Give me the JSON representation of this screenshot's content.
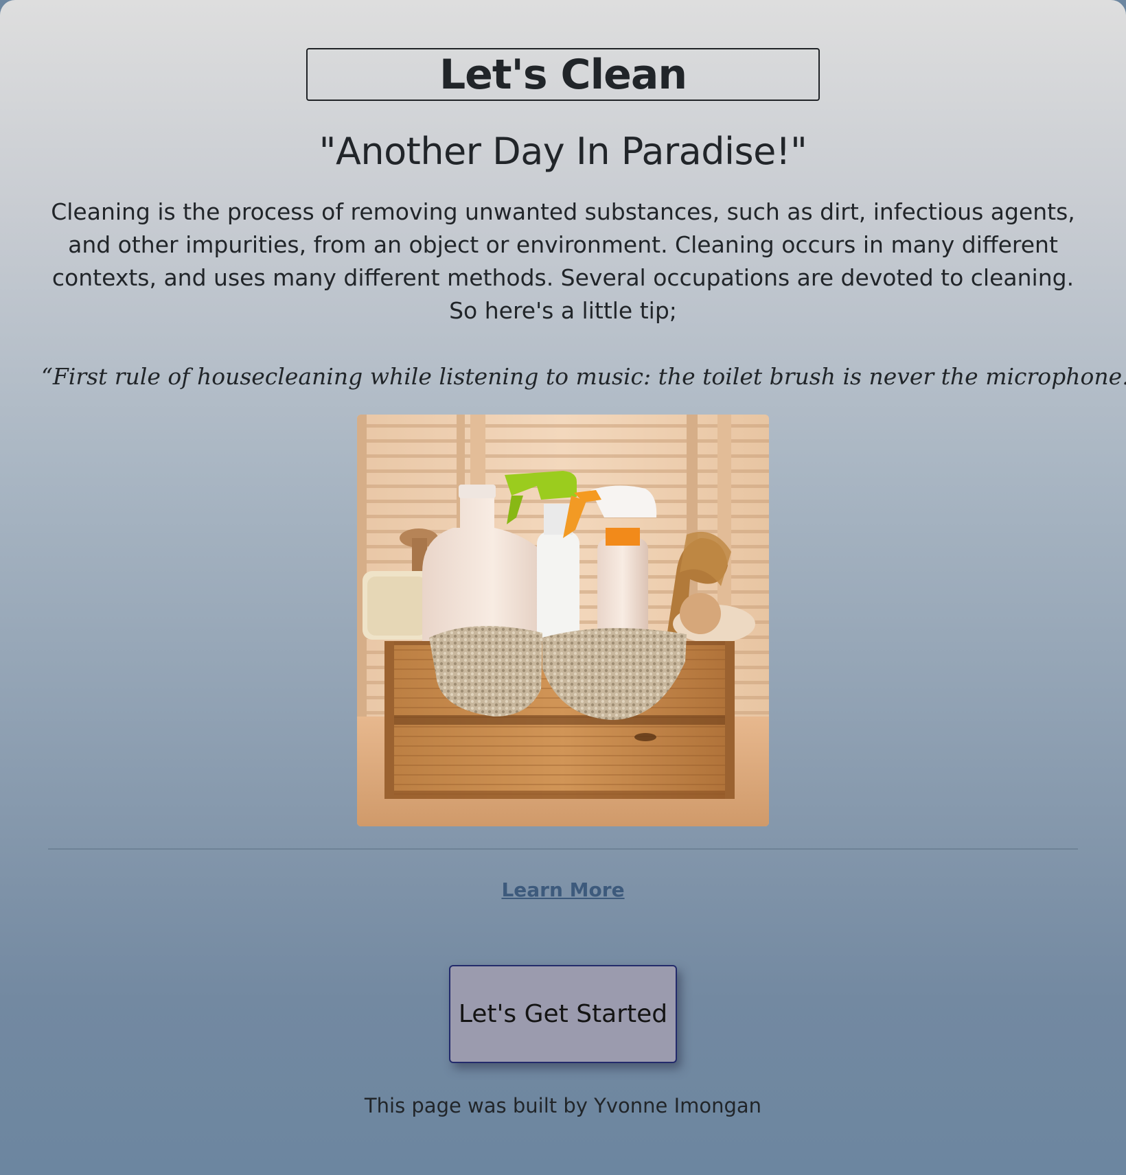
{
  "header": {
    "title": "Let's Clean",
    "subtitle": "\"Another Day In Paradise!\""
  },
  "main": {
    "description": "Cleaning is the process of removing unwanted substances, such as dirt, infectious agents, and other impurities, from an object or environment. Cleaning occurs in many different contexts, and uses many different methods. Several occupations are devoted to cleaning. So here's a little tip;",
    "quote_text": "“First rule of housecleaning while listening to music: the toilet brush is never the microphone. ",
    "quote_emoji": "👌",
    "quote_close": " ”",
    "image_subject": "cleaning-supplies-crate",
    "learn_more_label": "Learn More",
    "cta_label": "Let's Get Started"
  },
  "footer": {
    "credit": "This page was built by Yvonne Imongan"
  },
  "colors": {
    "text": "#212529",
    "link": "#3d5a7c",
    "button_bg": "#9b9bae",
    "button_border": "#222a6b"
  }
}
